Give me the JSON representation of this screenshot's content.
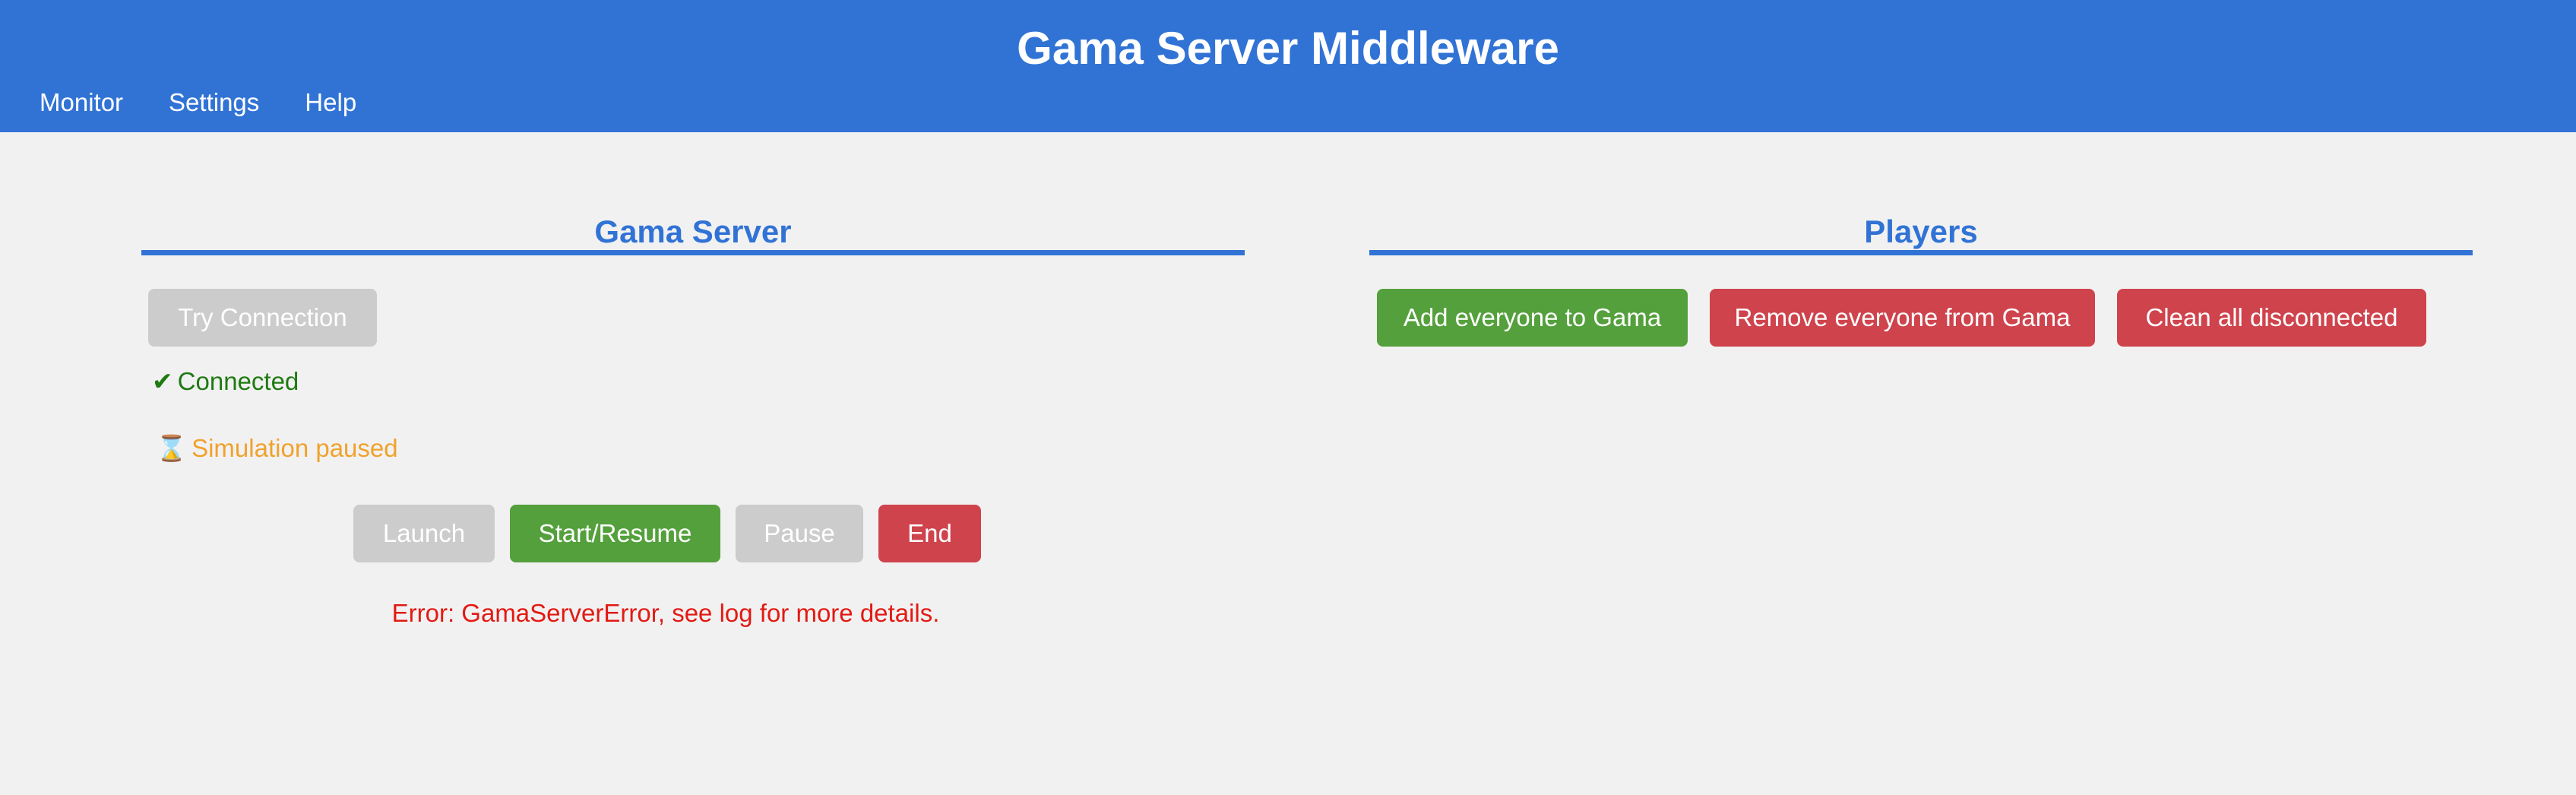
{
  "app": {
    "title": "Gama Server Middleware"
  },
  "nav": {
    "items": [
      "Monitor",
      "Settings",
      "Help"
    ]
  },
  "gama_server": {
    "title": "Gama Server",
    "try_connection_label": "Try Connection",
    "connection_icon": "✔",
    "connection_status": "Connected",
    "simulation_icon": "⌛",
    "simulation_status": "Simulation paused",
    "controls": {
      "launch": "Launch",
      "start_resume": "Start/Resume",
      "pause": "Pause",
      "end": "End"
    },
    "error": "Error: GamaServerError, see log for more details."
  },
  "players": {
    "title": "Players",
    "add_all": "Add everyone to Gama",
    "remove_all": "Remove everyone from Gama",
    "clean_disconnected": "Clean all disconnected"
  },
  "colors": {
    "header": "#3173d5",
    "accent": "#3173d5",
    "success": "#54a03c",
    "danger": "#cf434d",
    "disabled": "#cccccc",
    "connected_text": "#1f7a12",
    "paused_text": "#f0a22c",
    "error_text": "#e21a12"
  }
}
